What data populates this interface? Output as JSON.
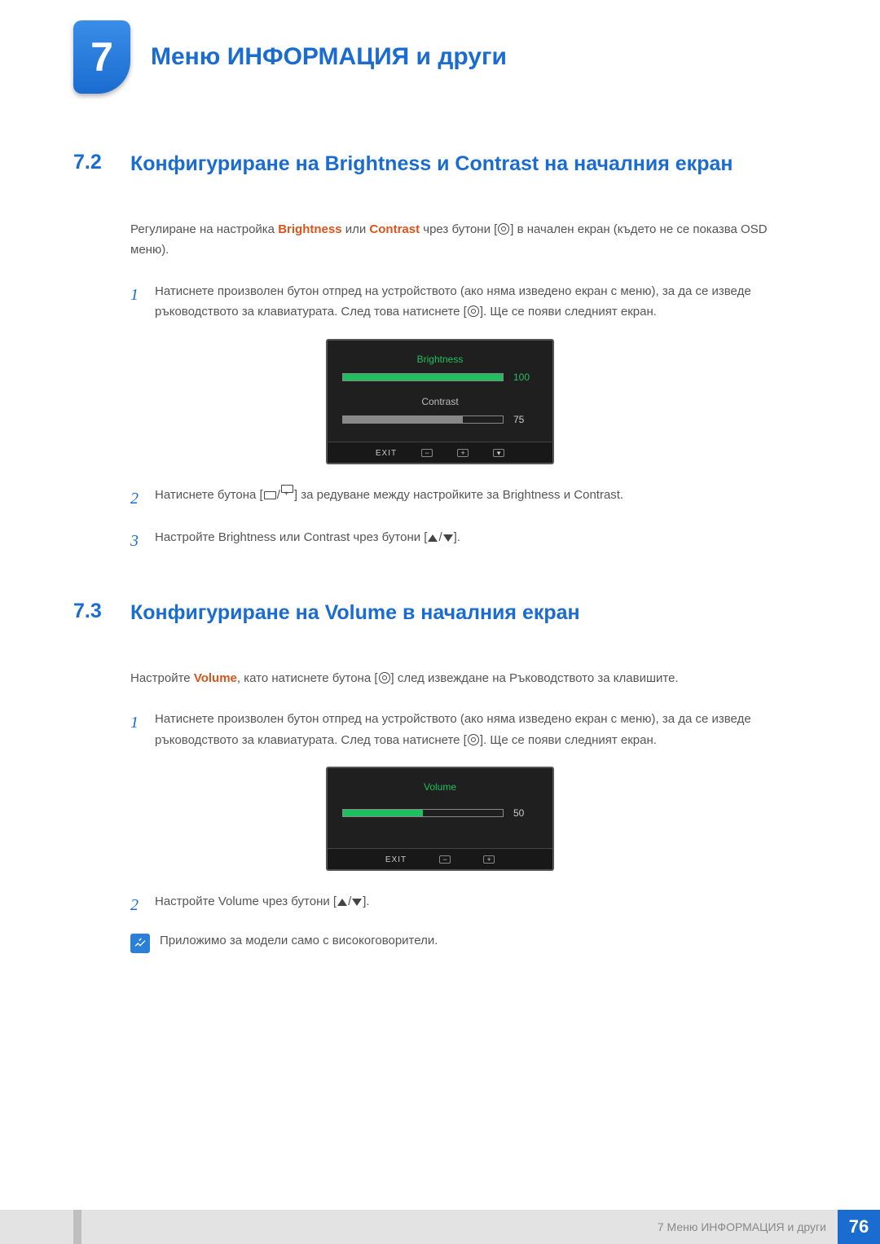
{
  "chapter": {
    "number": "7",
    "title": "Меню ИНФОРМАЦИЯ и други"
  },
  "section72": {
    "num": "7.2",
    "title": "Конфигуриране на Brightness и Contrast на началния екран",
    "intro_a": "Регулиране на настройка ",
    "intro_hl1": "Brightness",
    "intro_b": " или ",
    "intro_hl2": "Contrast",
    "intro_c": " чрез бутони [",
    "intro_d": "] в начален екран (където не се показва OSD меню).",
    "steps": {
      "s1a": "Натиснете произволен бутон отпред на устройството (ако няма изведено екран с меню), за да се изведе ръководството за клавиатурата. След това натиснете [",
      "s1b": "]. Ще се появи следният екран.",
      "s2a": "Натиснете бутона [",
      "s2b": "] за редуване между настройките за ",
      "s2hl1": "Brightness",
      "s2c": " и ",
      "s2hl2": "Contrast",
      "s2d": ".",
      "s3a": "Настройте ",
      "s3hl1": "Brightness",
      "s3b": " или ",
      "s3hl2": "Contrast",
      "s3c": " чрез бутони [",
      "s3d": "]."
    },
    "osd": {
      "brightness_label": "Brightness",
      "brightness_value": "100",
      "contrast_label": "Contrast",
      "contrast_value": "75",
      "exit": "EXIT"
    }
  },
  "section73": {
    "num": "7.3",
    "title": "Конфигуриране на Volume в началния екран",
    "intro_a": "Настройте ",
    "intro_hl": "Volume",
    "intro_b": ", като натиснете бутона [",
    "intro_c": "] след извеждане на Ръководството за клавишите.",
    "steps": {
      "s1a": "Натиснете произволен бутон отпред на устройството (ако няма изведено екран с меню), за да се изведе ръководството за клавиатурата. След това натиснете [",
      "s1b": "]. Ще се появи следният екран.",
      "s2a": "Настройте ",
      "s2hl": "Volume",
      "s2b": " чрез бутони [",
      "s2c": "]."
    },
    "osd": {
      "volume_label": "Volume",
      "volume_value": "50",
      "exit": "EXIT"
    },
    "note": "Приложимо за модели само с високоговорители."
  },
  "footer": {
    "chapter_ref": "7 Меню ИНФОРМАЦИЯ и други",
    "page": "76"
  },
  "chart_data": {
    "type": "table",
    "title": "OSD slider values shown in screenshots",
    "series": [
      {
        "name": "Brightness",
        "values": [
          100
        ]
      },
      {
        "name": "Contrast",
        "values": [
          75
        ]
      },
      {
        "name": "Volume",
        "values": [
          50
        ]
      }
    ]
  }
}
